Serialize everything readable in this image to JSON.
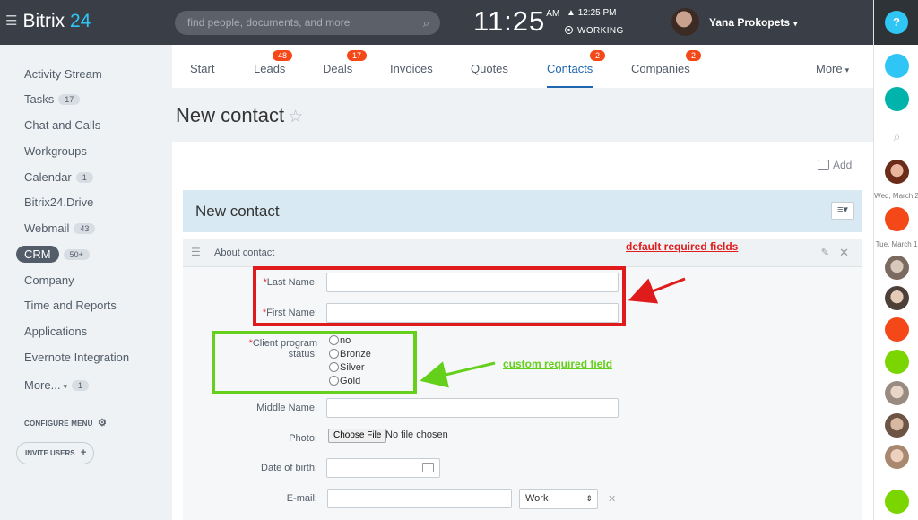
{
  "topbar": {
    "logo_text": "Bitrix",
    "logo_number": "24",
    "search_placeholder": "find people, documents, and more",
    "clock": "11:25",
    "clock_ampm": "AM",
    "work_time": "12:25 PM",
    "work_status": "WORKING",
    "user_name": "Yana Prokopets"
  },
  "rightbar": {
    "help_label": "?",
    "date1": "Wed, March 2",
    "date2": "Tue, March 1",
    "colors": {
      "blue": "#2fc6f6",
      "teal": "#00b4ac",
      "orange": "#f54819",
      "green": "#7bd500"
    }
  },
  "sidebar": {
    "items": [
      {
        "label": "Activity Stream",
        "badge": ""
      },
      {
        "label": "Tasks",
        "badge": "17"
      },
      {
        "label": "Chat and Calls",
        "badge": ""
      },
      {
        "label": "Workgroups",
        "badge": ""
      },
      {
        "label": "Calendar",
        "badge": "1"
      },
      {
        "label": "Bitrix24.Drive",
        "badge": ""
      },
      {
        "label": "Webmail",
        "badge": "43"
      },
      {
        "label": "CRM",
        "badge": "50+"
      },
      {
        "label": "Company",
        "badge": ""
      },
      {
        "label": "Time and Reports",
        "badge": ""
      },
      {
        "label": "Applications",
        "badge": ""
      },
      {
        "label": "Evernote Integration",
        "badge": ""
      },
      {
        "label": "More...",
        "badge": "1"
      }
    ],
    "configure_label": "CONFIGURE MENU",
    "invite_label": "INVITE USERS"
  },
  "tabs": [
    {
      "label": "Start",
      "count": ""
    },
    {
      "label": "Leads",
      "count": "48"
    },
    {
      "label": "Deals",
      "count": "17"
    },
    {
      "label": "Invoices",
      "count": ""
    },
    {
      "label": "Quotes",
      "count": ""
    },
    {
      "label": "Contacts",
      "count": "2"
    },
    {
      "label": "Companies",
      "count": "2"
    },
    {
      "label": "More",
      "count": ""
    }
  ],
  "page": {
    "title": "New contact",
    "add_label": "Add",
    "section_title": "New contact",
    "subsection_title": "About contact"
  },
  "form": {
    "last_name_label": "Last Name:",
    "first_name_label": "First Name:",
    "client_status_label": "Client program status:",
    "client_status_options": [
      "no",
      "Bronze",
      "Silver",
      "Gold"
    ],
    "middle_name_label": "Middle Name:",
    "photo_label": "Photo:",
    "file_button": "Choose File",
    "file_text": "No file chosen",
    "dob_label": "Date of birth:",
    "email_label": "E-mail:",
    "email_type": "Work",
    "required_mark": "*"
  },
  "annotations": {
    "default_note": "default required fields",
    "custom_note": "custom required field"
  }
}
